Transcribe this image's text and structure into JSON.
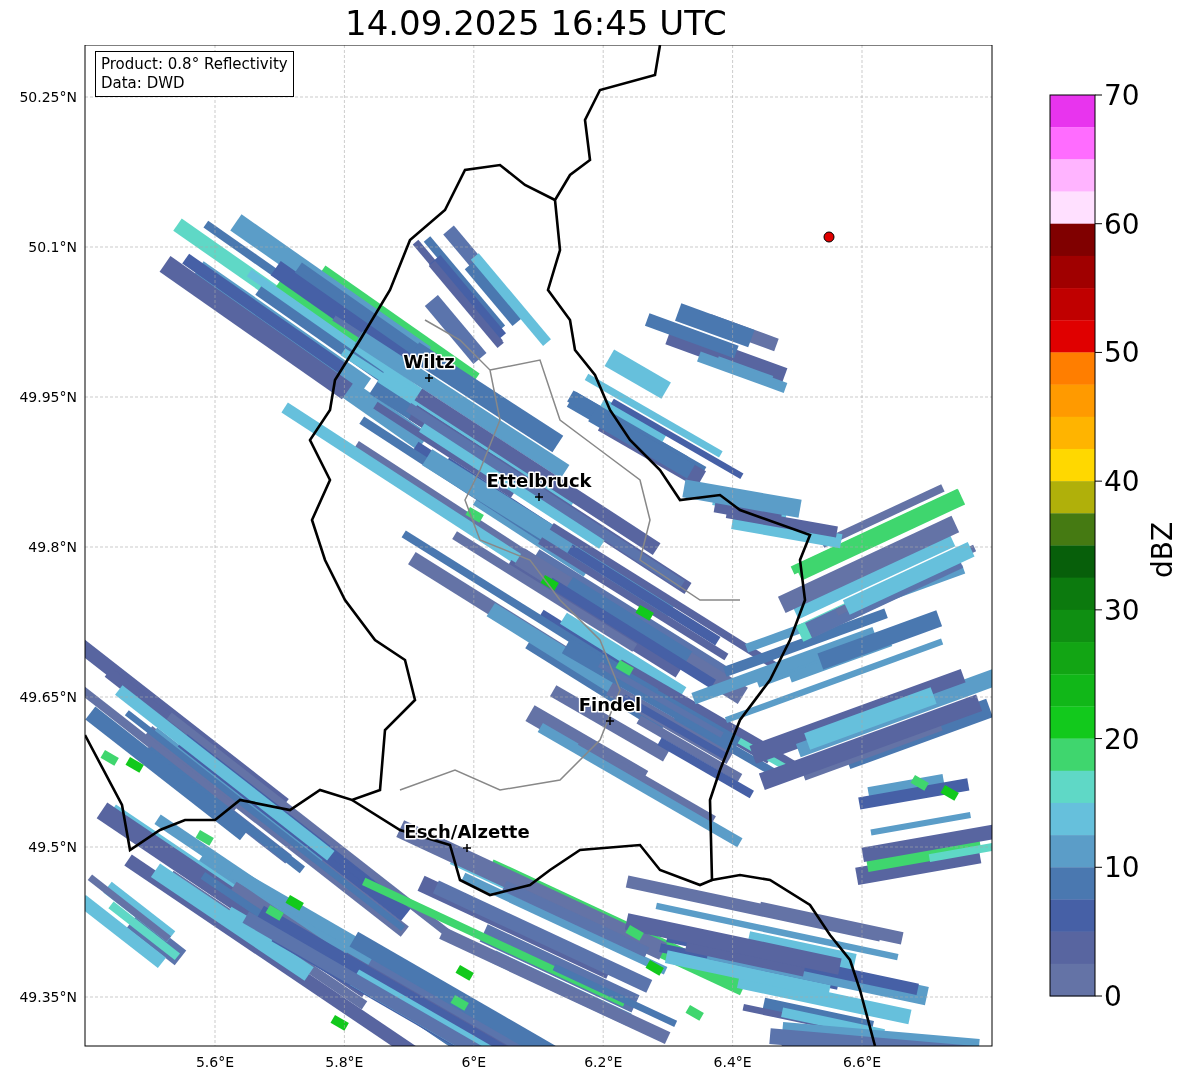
{
  "title": "14.09.2025 16:45 UTC",
  "info_box": {
    "lines": [
      "Product: 0.8° Reflectivity",
      "Data: DWD"
    ]
  },
  "map": {
    "lat_ticks": [
      "50.25°N",
      "50.1°N",
      "49.95°N",
      "49.8°N",
      "49.65°N",
      "49.5°N",
      "49.35°N"
    ],
    "lon_ticks": [
      "5.6°E",
      "5.8°E",
      "6°E",
      "6.2°E",
      "6.4°E",
      "6.6°E"
    ],
    "places": [
      {
        "name": "Wiltz"
      },
      {
        "name": "Ettelbruck"
      },
      {
        "name": "Findel"
      },
      {
        "name": "Esch/Alzette"
      }
    ]
  },
  "colorbar": {
    "label": "dBZ",
    "ticks": [
      "70",
      "60",
      "50",
      "40",
      "30",
      "20",
      "10",
      "0"
    ],
    "segments": [
      {
        "color": "#e834ee"
      },
      {
        "color": "#ff6cff"
      },
      {
        "color": "#ffb4ff"
      },
      {
        "color": "#ffe0ff"
      },
      {
        "color": "#800000"
      },
      {
        "color": "#a00000"
      },
      {
        "color": "#c00000"
      },
      {
        "color": "#e00000"
      },
      {
        "color": "#ff7e00"
      },
      {
        "color": "#ff9a00"
      },
      {
        "color": "#ffb400"
      },
      {
        "color": "#ffd800"
      },
      {
        "color": "#b0b00a"
      },
      {
        "color": "#457a12"
      },
      {
        "color": "#075f0a"
      },
      {
        "color": "#0c7a0e"
      },
      {
        "color": "#0f8f12"
      },
      {
        "color": "#12a514"
      },
      {
        "color": "#11b718"
      },
      {
        "color": "#12c91c"
      },
      {
        "color": "#3fd66e"
      },
      {
        "color": "#5fd8c6"
      },
      {
        "color": "#66c0dc"
      },
      {
        "color": "#5b9dc8"
      },
      {
        "color": "#4a78b0"
      },
      {
        "color": "#4660a6"
      },
      {
        "color": "#5865a0"
      },
      {
        "color": "#6473a6"
      }
    ]
  }
}
